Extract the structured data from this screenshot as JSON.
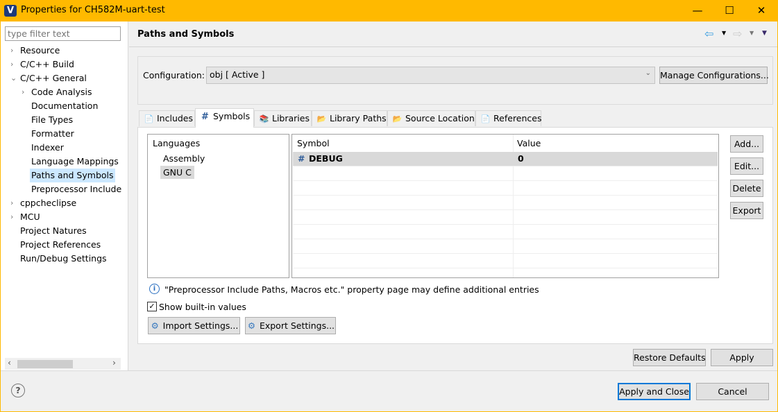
{
  "window": {
    "title": "Properties for CH582M-uart-test",
    "logo": "V",
    "minimize": "—",
    "maximize": "☐",
    "close": "✕",
    "accent": "#ffb900"
  },
  "sidebar": {
    "filter_placeholder": "type filter text",
    "items": [
      {
        "label": "Resource",
        "level": 0,
        "chevron": "›"
      },
      {
        "label": "C/C++ Build",
        "level": 0,
        "chevron": "›"
      },
      {
        "label": "C/C++ General",
        "level": 0,
        "chevron": "⌄"
      },
      {
        "label": "Code Analysis",
        "level": 1,
        "chevron": "›"
      },
      {
        "label": "Documentation",
        "level": 1
      },
      {
        "label": "File Types",
        "level": 1
      },
      {
        "label": "Formatter",
        "level": 1
      },
      {
        "label": "Indexer",
        "level": 1
      },
      {
        "label": "Language Mappings",
        "level": 1
      },
      {
        "label": "Paths and Symbols",
        "level": 1,
        "selected": true
      },
      {
        "label": "Preprocessor Include",
        "level": 1
      },
      {
        "label": "cppcheclipse",
        "level": 0,
        "chevron": "›"
      },
      {
        "label": "MCU",
        "level": 0,
        "chevron": "›"
      },
      {
        "label": "Project Natures",
        "level": 0
      },
      {
        "label": "Project References",
        "level": 0
      },
      {
        "label": "Run/Debug Settings",
        "level": 0
      }
    ],
    "scroll_left": "‹",
    "scroll_right": "›"
  },
  "page": {
    "title": "Paths and Symbols",
    "config_label": "Configuration:",
    "config_value": "obj  [ Active ]",
    "manage_button": "Manage Configurations...",
    "tabs": [
      {
        "label": "Includes",
        "icon": "includes-icon",
        "glyph": "📄"
      },
      {
        "label": "Symbols",
        "icon": "hash-icon",
        "glyph": "#"
      },
      {
        "label": "Libraries",
        "icon": "libraries-icon",
        "glyph": "📚"
      },
      {
        "label": "Library Paths",
        "icon": "library-paths-icon",
        "glyph": "📂"
      },
      {
        "label": "Source Location",
        "icon": "source-folder-icon",
        "glyph": "📂"
      },
      {
        "label": "References",
        "icon": "references-icon",
        "glyph": "📄"
      }
    ],
    "languages_header": "Languages",
    "languages": [
      "Assembly",
      "GNU C"
    ],
    "columns": [
      "Symbol",
      "Value"
    ],
    "rows": [
      {
        "symbol": "DEBUG",
        "value": "0"
      }
    ],
    "side_buttons": [
      "Add...",
      "Edit...",
      "Delete",
      "Export"
    ],
    "info": "\"Preprocessor Include Paths, Macros etc.\" property page may define additional entries",
    "show_builtin": "Show built-in values",
    "show_builtin_checked": true,
    "import": "Import Settings...",
    "export": "Export Settings...",
    "restore": "Restore Defaults",
    "apply": "Apply"
  },
  "footer": {
    "help": "?",
    "apply_close": "Apply and Close",
    "cancel": "Cancel"
  }
}
